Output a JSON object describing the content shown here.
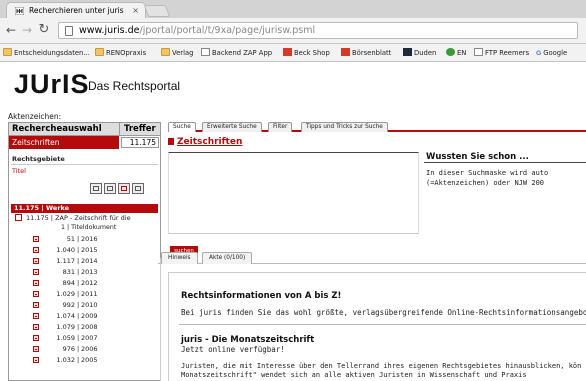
{
  "browser": {
    "tab_title": "Recherchieren unter juris",
    "tab_close": "×",
    "url_host": "www.juris.de",
    "url_path": "/jportal/portal/t/9xa/page/jurisw.psml"
  },
  "bookmarks": [
    {
      "label": "Entscheidungsdaten...",
      "icon": "folder-icon"
    },
    {
      "label": "RENOpraxis",
      "icon": "folder-icon"
    },
    {
      "label": "Verlag",
      "icon": "folder-icon"
    },
    {
      "label": "Backend ZAP App",
      "icon": "page-icon"
    },
    {
      "label": "Beck Shop",
      "icon": "beck-icon"
    },
    {
      "label": "Börsenblatt",
      "icon": "boersenblatt-icon"
    },
    {
      "label": "Duden",
      "icon": "duden-icon"
    },
    {
      "label": "EN",
      "icon": "globe-icon"
    },
    {
      "label": "FTP Reemers",
      "icon": "page-icon"
    },
    {
      "label": "Google",
      "icon": "google-icon"
    }
  ],
  "logo": {
    "word": "JUrIS",
    "tagline": "Das Rechtsportal"
  },
  "aktenzeichen_label": "Aktenzeichen:",
  "left": {
    "head_left": "Rechercheauswahl",
    "head_right": "Treffer",
    "selected_name": "Zeitschriften",
    "selected_count": "11.175",
    "rechtsgebiete": "Rechtsgebiete",
    "titel": "Titel",
    "werke": "11.175 | Werke",
    "zap": "11.175 | ZAP - Zeitschrift für die",
    "titeldok": "1 | Titeldokument",
    "years": [
      {
        "num": "51",
        "year": "2016"
      },
      {
        "num": "1.040",
        "year": "2015"
      },
      {
        "num": "1.117",
        "year": "2014"
      },
      {
        "num": "831",
        "year": "2013"
      },
      {
        "num": "894",
        "year": "2012"
      },
      {
        "num": "1.029",
        "year": "2011"
      },
      {
        "num": "992",
        "year": "2010"
      },
      {
        "num": "1.074",
        "year": "2009"
      },
      {
        "num": "1.079",
        "year": "2008"
      },
      {
        "num": "1.059",
        "year": "2007"
      },
      {
        "num": "976",
        "year": "2006"
      },
      {
        "num": "1.032",
        "year": "2005"
      }
    ]
  },
  "search": {
    "tabs": [
      "Suche",
      "Erweiterte Suche",
      "Filter",
      "Tipps und Tricks zur Suche"
    ],
    "title": "Zeitschriften",
    "button": "suchen",
    "wussten_title": "Wussten Sie schon ...",
    "wussten_line1": "In dieser Suchmaske wird auto",
    "wussten_line2": "(=Aktenzeichen) oder NJW 200"
  },
  "subtabs": [
    "Hinweis",
    "Akte (0/100)"
  ],
  "info": {
    "h1": "Rechtsinformationen von A bis Z!",
    "p1": "Bei juris finden Sie das wohl größte, verlagsübergreifende Online-Rechtsinformationsangebot D",
    "h2": "juris - Die Monatszeitschrift",
    "p2": "Jetzt online verfügbar!",
    "p3": "Juristen, die mit Interesse über den Tellerrand ihres eigenen Rechtsgebietes hinausblicken, kön",
    "p4": "Monatszeitschrift\" wendet sich an alle aktiven Juristen in Wissenschaft und Praxis"
  },
  "colors": {
    "brand_red": "#b30b0b"
  }
}
